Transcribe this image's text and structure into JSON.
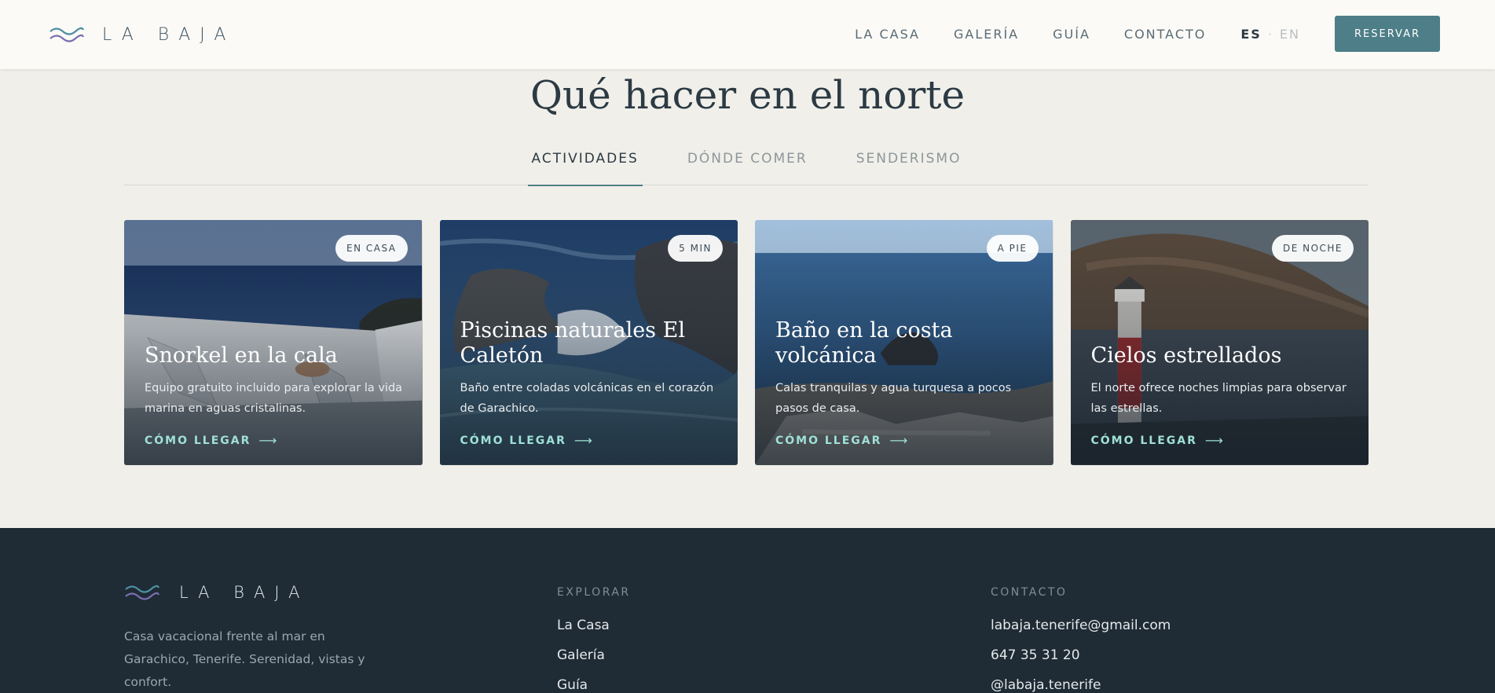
{
  "header": {
    "logo_text": "LA BAJA",
    "nav": [
      "LA CASA",
      "GALERÍA",
      "GUÍA",
      "CONTACTO"
    ],
    "lang_active": "ES",
    "lang_separator": "·",
    "lang_inactive": "EN",
    "reserve_label": "RESERVAR",
    "accent": "#4e7e88"
  },
  "section": {
    "title": "Qué hacer en el norte",
    "tabs": [
      "ACTIVIDADES",
      "DÓNDE COMER",
      "SENDERISMO"
    ],
    "active_tab": "ACTIVIDADES"
  },
  "cards": [
    {
      "badge": "EN CASA",
      "title": "Snorkel en la cala",
      "desc": "Equipo gratuito incluido para explorar la vida marina en aguas cristalinas.",
      "link": "CÓMO LLEGAR",
      "arrow": "⟶"
    },
    {
      "badge": "5 MIN",
      "title": "Piscinas naturales El Caletón",
      "desc": "Baño entre coladas volcánicas en el corazón de Garachico.",
      "link": "CÓMO LLEGAR",
      "arrow": "⟶"
    },
    {
      "badge": "A PIE",
      "title": "Baño en la costa volcánica",
      "desc": "Calas tranquilas y agua turquesa a pocos pasos de casa.",
      "link": "CÓMO LLEGAR",
      "arrow": "⟶"
    },
    {
      "badge": "DE NOCHE",
      "title": "Cielos estrellados",
      "desc": "El norte ofrece noches limpias para observar las estrellas.",
      "link": "CÓMO LLEGAR",
      "arrow": "⟶"
    }
  ],
  "footer": {
    "logo_text": "LA BAJA",
    "desc": "Casa vacacional frente al mar en Garachico, Tenerife. Serenidad, vistas y confort.",
    "explore_heading": "EXPLORAR",
    "explore_links": [
      "La Casa",
      "Galería",
      "Guía"
    ],
    "contact_heading": "CONTACTO",
    "contact_links": [
      "labaja.tenerife@gmail.com",
      "647 35 31 20",
      "@labaja.tenerife"
    ]
  }
}
